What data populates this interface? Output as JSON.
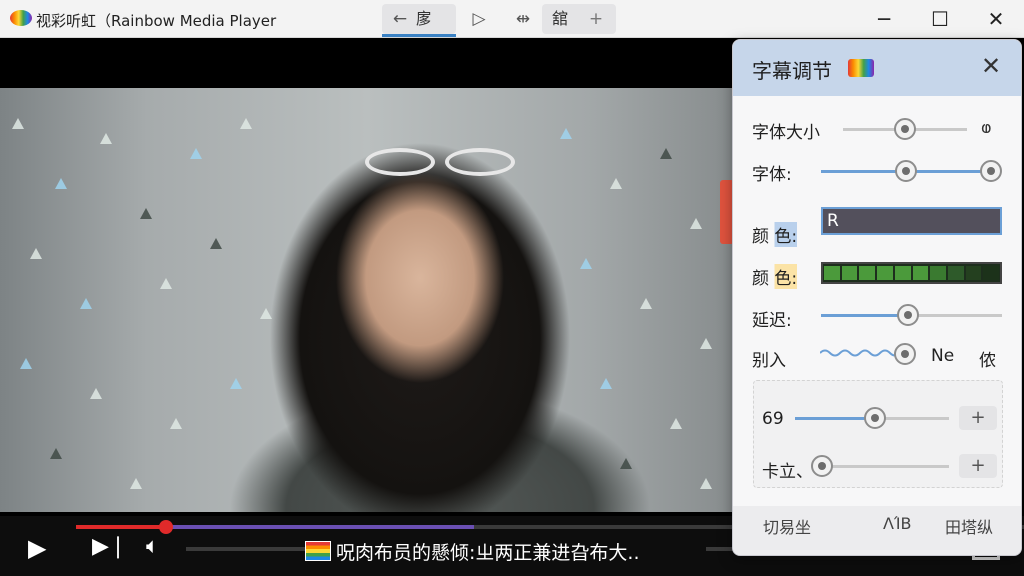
{
  "window": {
    "title": "视彩听虹（Rainbow Media Player",
    "toolbar": {
      "back_label": "扅",
      "back_arrow": "←",
      "play": "▷",
      "move": "⇹",
      "tool_label": "舘"
    },
    "controls": {
      "minimize": "─",
      "maximize": "☐",
      "close": "✕"
    }
  },
  "player": {
    "progress_fraction": 0.095,
    "buffer_fraction": 0.42,
    "caption": "呪肉布员的懸倾:ㄓ两正兼进旮布大.."
  },
  "panel": {
    "title": "字幕调节",
    "rows": {
      "font_size": {
        "label": "字体大小",
        "end": "ⱷ",
        "value": 0.5
      },
      "font": {
        "label": "字体:",
        "value_min": 0.5,
        "value_max": 1.0
      },
      "color1": {
        "label": "颜 色:",
        "value": "R"
      },
      "color2": {
        "label": "颜 色:"
      },
      "delay": {
        "label": "延迟:",
        "value": 0.48
      },
      "effect": {
        "label": "别入",
        "value": 0.99,
        "end_label_1": "Ne",
        "end_label_2": "侬"
      },
      "size69": {
        "label": "69",
        "value": 0.52,
        "button": "+"
      },
      "pos": {
        "label": "卡立、",
        "value": 0.02,
        "button": "+"
      }
    },
    "footer": {
      "label_1": "切易坐",
      "label_2": "ΛΊB",
      "label_3": "田塔纵"
    }
  },
  "colors": {
    "accent": "#6b9fd6",
    "progress": "#e02a2a",
    "panel_header": "#c6d6ea"
  },
  "icons": {
    "play": "play-icon",
    "next": "skip-next-icon",
    "volume": "volume-icon",
    "settings": "gear-icon",
    "fullscreen": "fullscreen-icon"
  }
}
